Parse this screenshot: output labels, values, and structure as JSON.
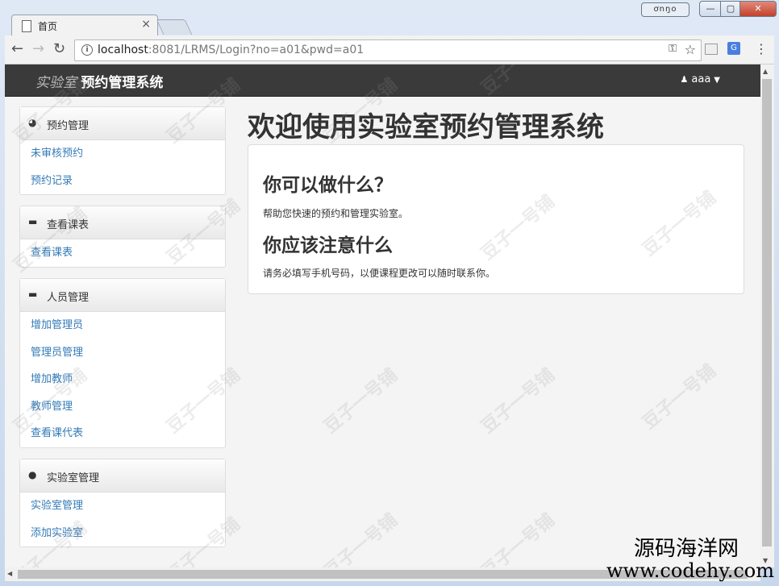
{
  "browser": {
    "tab_title": "首页",
    "tab_close": "×",
    "user_badge": "ơnŋo",
    "win_min": "—",
    "win_max": "▢",
    "win_close": "✕",
    "url_host": "localhost",
    "url_rest": ":8081/LRMS/Login?no=a01&pwd=a01"
  },
  "navbar": {
    "brand_light": "实验室",
    "brand_bold": "预约管理系统",
    "user": "aaa"
  },
  "sidebar": {
    "panels": [
      {
        "title": "预约管理",
        "icon": "dashboard-icon",
        "links": [
          "未审核预约",
          "预约记录"
        ]
      },
      {
        "title": "查看课表",
        "icon": "briefcase-icon",
        "links": [
          "查看课表"
        ]
      },
      {
        "title": "人员管理",
        "icon": "briefcase-icon",
        "links": [
          "增加管理员",
          "管理员管理",
          "增加教师",
          "教师管理",
          "查看课代表"
        ]
      },
      {
        "title": "实验室管理",
        "icon": "exclamation-circle-icon",
        "links": [
          "实验室管理",
          "添加实验室"
        ]
      }
    ]
  },
  "main": {
    "title": "欢迎使用实验室预约管理系统",
    "section1_title": "你可以做什么？",
    "section1_text": "帮助您快速的预约和管理实验室。",
    "section2_title": "你应该注意什么",
    "section2_text": "请务必填写手机号码，以便课程更改可以随时联系你。"
  },
  "watermark": {
    "text": "豆子一号铺",
    "site_name": "源码海洋网",
    "site_url": "www.codehy.com"
  }
}
